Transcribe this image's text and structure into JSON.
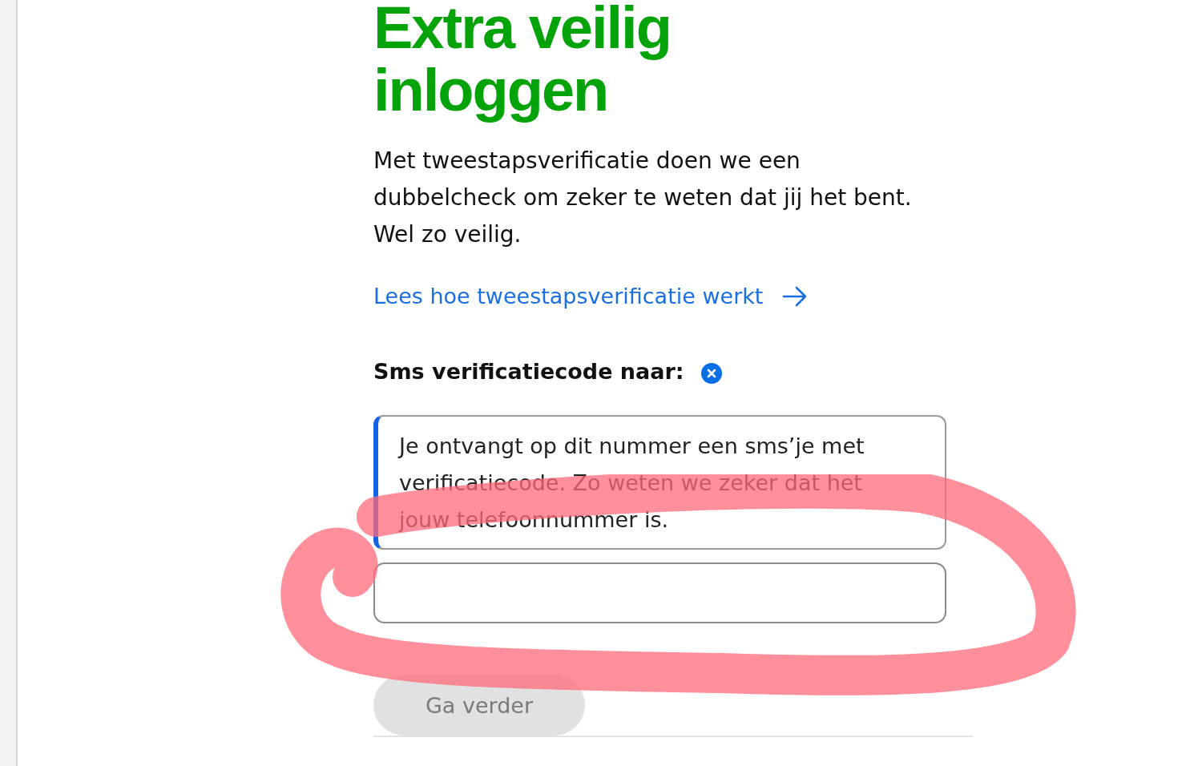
{
  "title": "Extra veilig inloggen",
  "intro": "Met tweestapsverificatie doen we een dubbelcheck om zeker te weten dat jij het bent. Wel zo veilig.",
  "link": {
    "label": "Lees hoe tweestapsverificatie werkt"
  },
  "sms_heading": "Sms verificatiecode naar:",
  "info": "Je ontvangt op dit nummer een sms’je met verificatiecode. Zo weten we zeker dat het jouw telefoonnummer is.",
  "continue_button": {
    "label": "Ga verder",
    "disabled": true
  }
}
